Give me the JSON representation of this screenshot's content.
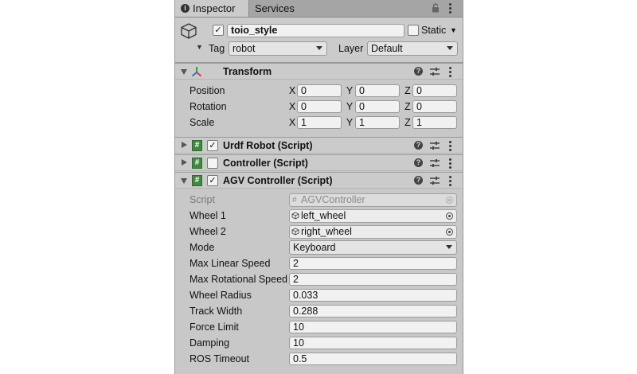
{
  "tabs": [
    {
      "label": "Inspector",
      "icon": "info-icon"
    },
    {
      "label": "Services"
    }
  ],
  "header": {
    "active_checked": true,
    "name": "toio_style",
    "static_label": "Static",
    "static_checked": false,
    "tag_label": "Tag",
    "tag_value": "robot",
    "layer_label": "Layer",
    "layer_value": "Default"
  },
  "transform": {
    "title": "Transform",
    "expanded": true,
    "rows": [
      {
        "label": "Position",
        "x": "0",
        "y": "0",
        "z": "0"
      },
      {
        "label": "Rotation",
        "x": "0",
        "y": "0",
        "z": "0"
      },
      {
        "label": "Scale",
        "x": "1",
        "y": "1",
        "z": "1"
      }
    ],
    "axis": {
      "x": "X",
      "y": "Y",
      "z": "Z"
    }
  },
  "components": [
    {
      "title": "Urdf Robot (Script)",
      "enabled": true,
      "expanded": false
    },
    {
      "title": "Controller (Script)",
      "enabled": false,
      "expanded": false
    },
    {
      "title": "AGV Controller (Script)",
      "enabled": true,
      "expanded": true
    }
  ],
  "agv": {
    "script": {
      "label": "Script",
      "value": "AGVController"
    },
    "wheel1": {
      "label": "Wheel 1",
      "value": "left_wheel"
    },
    "wheel2": {
      "label": "Wheel 2",
      "value": "right_wheel"
    },
    "mode": {
      "label": "Mode",
      "value": "Keyboard"
    },
    "fields": [
      {
        "label": "Max Linear Speed",
        "value": "2"
      },
      {
        "label": "Max Rotational Speed",
        "value": "2"
      },
      {
        "label": "Wheel Radius",
        "value": "0.033"
      },
      {
        "label": "Track Width",
        "value": "0.288"
      },
      {
        "label": "Force Limit",
        "value": "10"
      },
      {
        "label": "Damping",
        "value": "10"
      },
      {
        "label": "ROS Timeout",
        "value": "0.5"
      }
    ]
  },
  "colors": {
    "panel": "#c8c8c8",
    "tabbar": "#a5a5a5",
    "script_icon": "#3d8a3d"
  }
}
